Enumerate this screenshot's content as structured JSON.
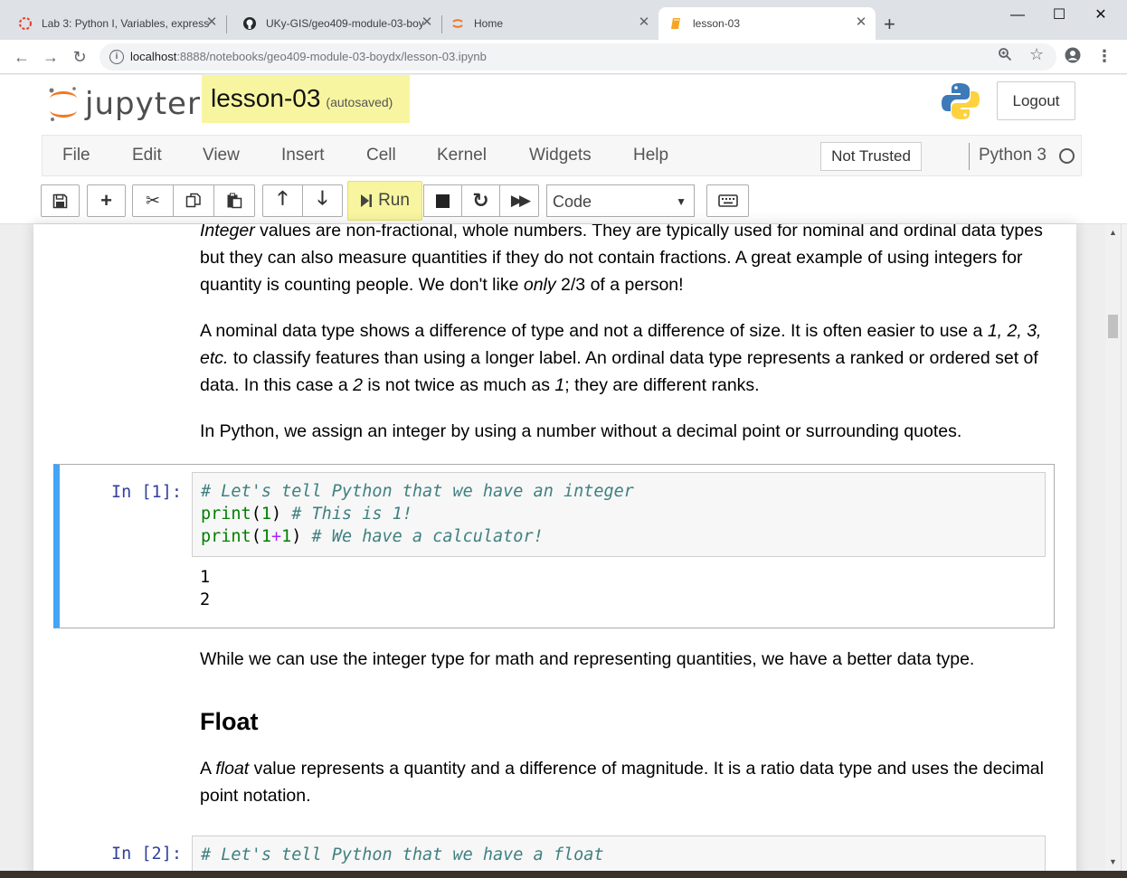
{
  "browser": {
    "tabs": [
      {
        "label": "Lab 3: Python I, Variables, express",
        "icon": "canvas-icon"
      },
      {
        "label": "UKy-GIS/geo409-module-03-boy",
        "icon": "github-icon"
      },
      {
        "label": "Home",
        "icon": "jupyter-icon"
      },
      {
        "label": "lesson-03",
        "icon": "notebook-icon"
      }
    ],
    "new_tab": "+",
    "url_host": "localhost",
    "url_rest": ":8888/notebooks/geo409-module-03-boydx/lesson-03.ipynb"
  },
  "jupyter": {
    "logo_text": "jupyter",
    "notebook_name": "lesson-03",
    "autosave": "(autosaved)",
    "logout": "Logout",
    "menu": [
      "File",
      "Edit",
      "View",
      "Insert",
      "Cell",
      "Kernel",
      "Widgets",
      "Help"
    ],
    "trust": "Not Trusted",
    "kernel": "Python 3",
    "run_label": "Run",
    "cell_type": "Code"
  },
  "notebook": {
    "md1": {
      "p1_em": "Integer",
      "p1_a": " values are non-fractional, whole numbers. They are typically used for nominal and ordinal data types but they can also measure quantities if they do not contain fractions. A great example of using integers for quantity is counting people. We don't like ",
      "p1_em2": "only",
      "p1_b": " 2/3 of a person!",
      "p2_a": "A nominal data type shows a difference of type and not a difference of size. It is often easier to use a ",
      "p2_em": "1, 2, 3, etc.",
      "p2_b": " to classify features than using a longer label. An ordinal data type represents a ranked or ordered set of data. In this case a ",
      "p2_em2": "2",
      "p2_c": " is not twice as much as ",
      "p2_em3": "1",
      "p2_d": "; they are different ranks.",
      "p3": "In Python, we assign an integer by using a number without a decimal point or surrounding quotes."
    },
    "cell1": {
      "prompt": "In [1]:",
      "line1": "# Let's tell Python that we have an integer",
      "line2_fn": "print",
      "line2_open": "(",
      "line2_num": "1",
      "line2_close": ")",
      "line2_comment": " # This is 1!",
      "line3_fn": "print",
      "line3_open": "(",
      "line3_num1": "1",
      "line3_op": "+",
      "line3_num2": "1",
      "line3_close": ")",
      "line3_comment": " # We have a calculator!",
      "output": [
        "1",
        "2"
      ]
    },
    "md2": "While we can use the integer type for math and representing quantities, we have a better data type.",
    "heading": "Float",
    "md3_a": "A ",
    "md3_em": "float",
    "md3_b": " value represents a quantity and a difference of magnitude. It is a ratio data type and uses the decimal point notation.",
    "cell2": {
      "prompt": "In [2]:",
      "line1": "# Let's tell Python that we have a float"
    }
  }
}
